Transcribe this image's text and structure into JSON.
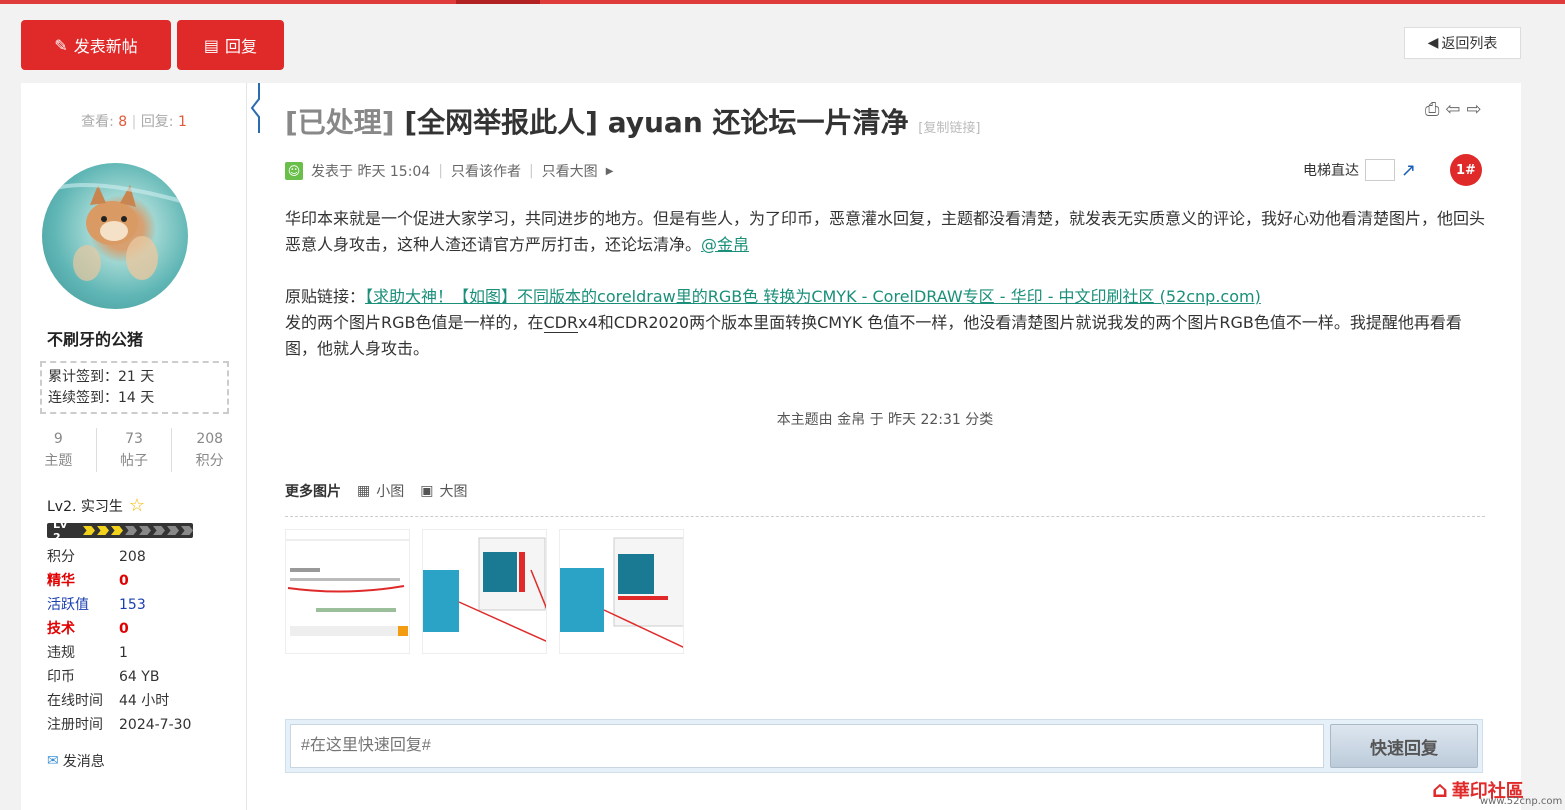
{
  "toolbar": {
    "new_post_label": "发表新帖",
    "reply_label": "回复",
    "back_label": "返回列表"
  },
  "sidebar": {
    "views_label": "查看:",
    "views_count": "8",
    "replies_label": "回复:",
    "replies_count": "1",
    "username": "不刷牙的公猪",
    "sign_total": "累计签到：21 天",
    "sign_streak": "连续签到：14 天",
    "stats": [
      {
        "value": "9",
        "label": "主题"
      },
      {
        "value": "73",
        "label": "帖子"
      },
      {
        "value": "208",
        "label": "积分"
      }
    ],
    "level": "Lv2. 实习生",
    "level_badge": "Lv 2",
    "level_progress": 0.4,
    "info": [
      {
        "key": "积分",
        "value": "208",
        "color": "#333333"
      },
      {
        "key": "精华",
        "value": "0",
        "color": "#e00000"
      },
      {
        "key": "活跃值",
        "value": "153",
        "color": "#1a3fb0"
      },
      {
        "key": "技术",
        "value": "0",
        "color": "#e00000"
      },
      {
        "key": "违规",
        "value": "1",
        "color": "#333333"
      },
      {
        "key": "印币",
        "value": "64 YB",
        "color": "#333333"
      },
      {
        "key": "在线时间",
        "value": "44 小时",
        "color": "#333333"
      },
      {
        "key": "注册时间",
        "value": "2024-7-30",
        "color": "#333333"
      }
    ],
    "message_label": "发消息"
  },
  "post": {
    "tag": "[已处理]",
    "title": "[全网举报此人] ayuan 还论坛一片清净",
    "copy_link": "[复制链接]",
    "posted": "发表于 昨天 15:04",
    "only_author": "只看该作者",
    "only_big": "只看大图",
    "elevator_label": "电梯直达",
    "floor": "1#",
    "paragraph1": "华印本来就是一个促进大家学习，共同进步的地方。但是有些人，为了印币，恶意灌水回复，主题都没看清楚，就发表无实质意义的评论，我好心劝他看清楚图片，他回头恶意人身攻击，这种人渣还请官方严厉打击，还论坛清净。",
    "mention": "@金帛",
    "link_prefix": "原贴链接：",
    "link_text": "【求助大神！【如图】不同版本的coreldraw里的RGB色 转换为CMYK - CorelDRAW专区 - 华印 - 中文印刷社区 (52cnp.com)",
    "paragraph2a": "发的两个图片RGB色值是一样的，在",
    "paragraph2_cdr": "CDR",
    "paragraph2b": "x4和CDR2020两个版本里面转换CMYK   色值不一样，他没看清楚图片就说我发的两个图片RGB色值不一样。我提醒他再看看图，他就人身攻击。",
    "classified": "本主题由 金帛 于 昨天 22:31 分类",
    "more_pics": "更多图片",
    "small_pics": "小图",
    "big_pics": "大图"
  },
  "reply": {
    "placeholder": "#在这里快速回复#",
    "send_label": "快速回复"
  },
  "watermark": {
    "text": "華印社區",
    "url": "www.52cnp.com"
  }
}
